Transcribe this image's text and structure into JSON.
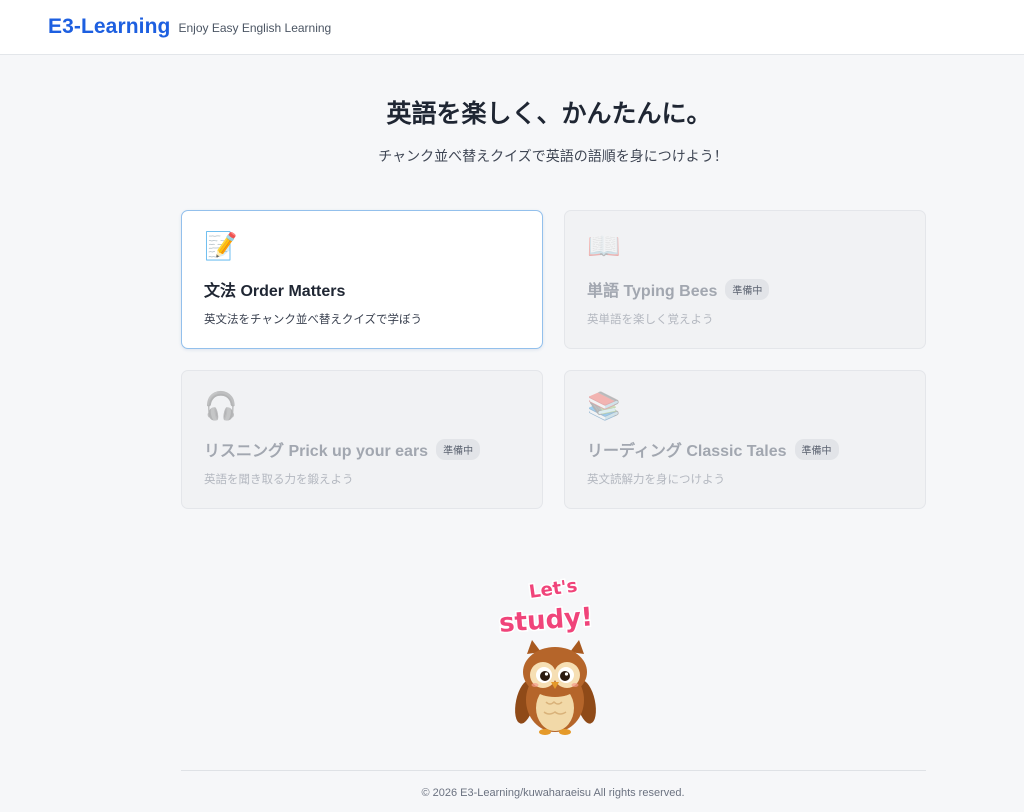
{
  "header": {
    "brand": "E3-Learning",
    "tagline": "Enjoy Easy English Learning"
  },
  "hero": {
    "title": "英語を楽しく、かんたんに。",
    "subtitle": "チャンク並べ替えクイズで英語の語順を身につけよう！"
  },
  "cards": [
    {
      "icon": "📝",
      "icon_name": "memo-pencil-icon",
      "title": "文法 Order Matters",
      "badge": "",
      "description": "英文法をチャンク並べ替えクイズで学ぼう",
      "available": true
    },
    {
      "icon": "📖",
      "icon_name": "open-book-icon",
      "title": "単語 Typing Bees",
      "badge": "準備中",
      "description": "英単語を楽しく覚えよう",
      "available": false
    },
    {
      "icon": "🎧",
      "icon_name": "headphones-icon",
      "title": "リスニング Prick up your ears",
      "badge": "準備中",
      "description": "英語を聞き取る力を鍛えよう",
      "available": false
    },
    {
      "icon": "📚",
      "icon_name": "stacked-books-icon",
      "title": "リーディング Classic Tales",
      "badge": "準備中",
      "description": "英文読解力を身につけよう",
      "available": false
    }
  ],
  "mascot": {
    "line1": "Let's",
    "line2": "study!"
  },
  "footer": {
    "copyright": "© 2026 E3-Learning/kuwaharaeisu All rights reserved."
  },
  "colors": {
    "brand": "#1d5fe0",
    "active_border": "#93c0ec",
    "mascot_text": "#f0447a",
    "owl_body": "#b5652a"
  }
}
